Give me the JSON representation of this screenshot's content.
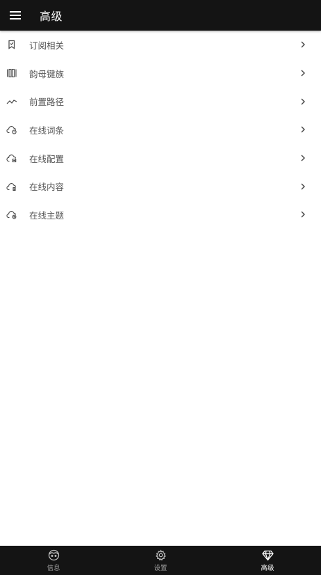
{
  "header": {
    "title": "高级"
  },
  "menu": {
    "items": [
      {
        "label": "订阅相关",
        "icon": "bookmark-icon"
      },
      {
        "label": "韵母键族",
        "icon": "keys-icon"
      },
      {
        "label": "前置路径",
        "icon": "path-icon"
      },
      {
        "label": "在线词条",
        "icon": "cloud-words-icon"
      },
      {
        "label": "在线配置",
        "icon": "cloud-config-icon"
      },
      {
        "label": "在线内容",
        "icon": "cloud-content-icon"
      },
      {
        "label": "在线主题",
        "icon": "cloud-theme-icon"
      }
    ]
  },
  "bottom_nav": {
    "items": [
      {
        "label": "信息",
        "icon": "face-icon"
      },
      {
        "label": "设置",
        "icon": "gear-icon"
      },
      {
        "label": "高级",
        "icon": "diamond-icon"
      }
    ],
    "active": "高级"
  },
  "colors": {
    "bar_background": "#141414",
    "label_text": "#555555",
    "active_nav": "#ffffff",
    "inactive_nav": "#9a9a9a"
  }
}
